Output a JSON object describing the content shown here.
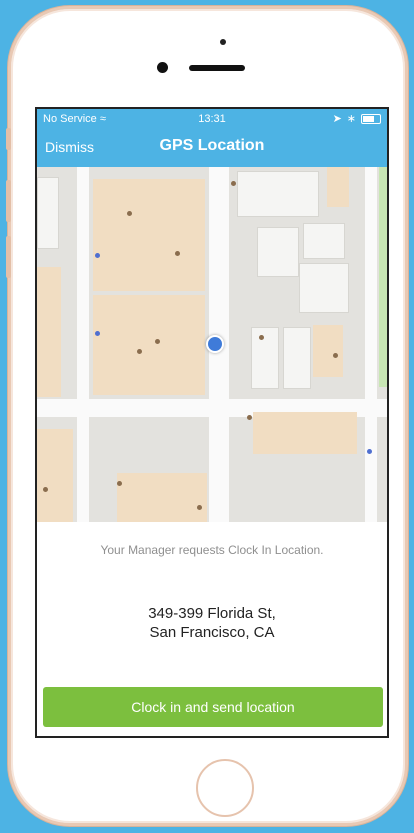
{
  "status_bar": {
    "carrier": "No Service",
    "time": "13:31"
  },
  "nav": {
    "dismiss_label": "Dismiss",
    "title": "GPS Location"
  },
  "map": {
    "pin_label": "current-location"
  },
  "request_text": "Your Manager requests Clock In Location.",
  "address": {
    "line1": "349-399 Florida St,",
    "line2": "San Francisco, CA"
  },
  "button": {
    "clock_in_label": "Clock in and send location"
  },
  "colors": {
    "accent": "#4db3e4",
    "button": "#7cbf3e"
  }
}
